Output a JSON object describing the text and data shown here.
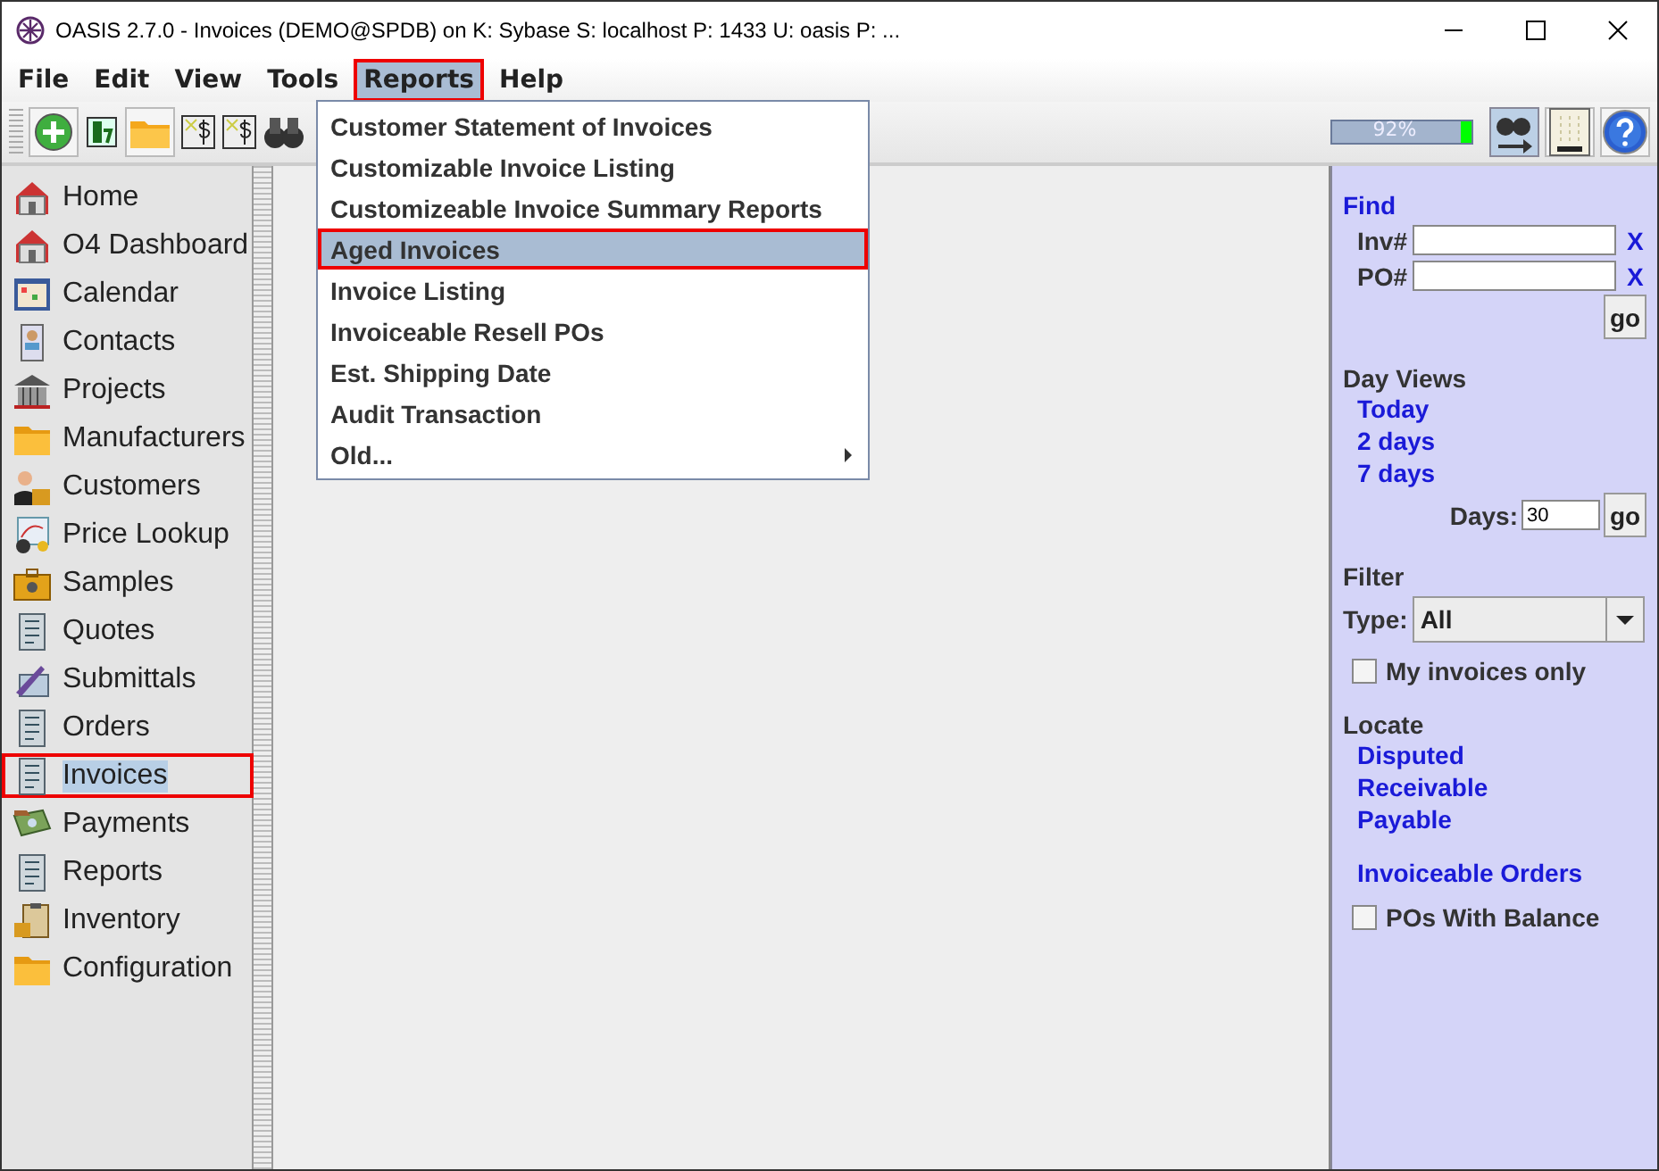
{
  "window": {
    "title": "OASIS 2.7.0 - Invoices (DEMO@SPDB) on K: Sybase  S: localhost  P: 1433  U: oasis  P: ..."
  },
  "menu_bar": [
    {
      "label": "File",
      "selected": false,
      "outlined": false
    },
    {
      "label": "Edit",
      "selected": false,
      "outlined": false
    },
    {
      "label": "View",
      "selected": false,
      "outlined": false
    },
    {
      "label": "Tools",
      "selected": false,
      "outlined": false
    },
    {
      "label": "Reports",
      "selected": true,
      "outlined": true
    },
    {
      "label": "Help",
      "selected": false,
      "outlined": false
    }
  ],
  "reports_menu": [
    {
      "label": "Customer Statement of Invoices",
      "selected": false,
      "outlined": false,
      "submenu": false
    },
    {
      "label": "Customizable Invoice Listing",
      "selected": false,
      "outlined": false,
      "submenu": false
    },
    {
      "label": "Customizeable Invoice Summary Reports",
      "selected": false,
      "outlined": false,
      "submenu": false
    },
    {
      "label": "Aged Invoices",
      "selected": true,
      "outlined": true,
      "submenu": false
    },
    {
      "label": "Invoice Listing",
      "selected": false,
      "outlined": false,
      "submenu": false
    },
    {
      "label": "Invoiceable Resell POs",
      "selected": false,
      "outlined": false,
      "submenu": false
    },
    {
      "label": "Est. Shipping Date",
      "selected": false,
      "outlined": false,
      "submenu": false
    },
    {
      "label": "Audit Transaction",
      "selected": false,
      "outlined": false,
      "submenu": false
    },
    {
      "label": "Old...",
      "selected": false,
      "outlined": false,
      "submenu": true
    }
  ],
  "memory": {
    "reading": "92%",
    "level": 0.92
  },
  "sidebar": {
    "items": [
      {
        "label": "Home",
        "selected": false,
        "outlined": false
      },
      {
        "label": "O4 Dashboard",
        "selected": false,
        "outlined": false
      },
      {
        "label": "Calendar",
        "selected": false,
        "outlined": false
      },
      {
        "label": "Contacts",
        "selected": false,
        "outlined": false
      },
      {
        "label": "Projects",
        "selected": false,
        "outlined": false
      },
      {
        "label": "Manufacturers",
        "selected": false,
        "outlined": false
      },
      {
        "label": "Customers",
        "selected": false,
        "outlined": false
      },
      {
        "label": "Price Lookup",
        "selected": false,
        "outlined": false
      },
      {
        "label": "Samples",
        "selected": false,
        "outlined": false
      },
      {
        "label": "Quotes",
        "selected": false,
        "outlined": false
      },
      {
        "label": "Submittals",
        "selected": false,
        "outlined": false
      },
      {
        "label": "Orders",
        "selected": false,
        "outlined": false
      },
      {
        "label": "Invoices",
        "selected": true,
        "outlined": true
      },
      {
        "label": "Payments",
        "selected": false,
        "outlined": false
      },
      {
        "label": "Reports",
        "selected": false,
        "outlined": false
      },
      {
        "label": "Inventory",
        "selected": false,
        "outlined": false
      },
      {
        "label": "Configuration",
        "selected": false,
        "outlined": false
      }
    ]
  },
  "panel": {
    "find": {
      "title": "Find",
      "fields": [
        {
          "label": "Inv#",
          "clear": "X"
        },
        {
          "label": "PO#",
          "clear": "X"
        }
      ],
      "button": "go"
    },
    "day_views": {
      "title": "Day Views",
      "links": [
        "Today",
        "2 days",
        "7 days"
      ],
      "days_label": "Days:",
      "days_value": "30",
      "button": "go"
    },
    "filter": {
      "title": "Filter",
      "type_label": "Type:",
      "type_value": "All",
      "checkbox": {
        "label": "My invoices only",
        "checked": false
      }
    },
    "locate": {
      "title": "Locate",
      "links": [
        "Disputed",
        "Receivable",
        "Payable"
      ],
      "extra_link": "Invoiceable Orders",
      "checkbox": {
        "label": "POs With Balance",
        "checked": false
      }
    }
  }
}
